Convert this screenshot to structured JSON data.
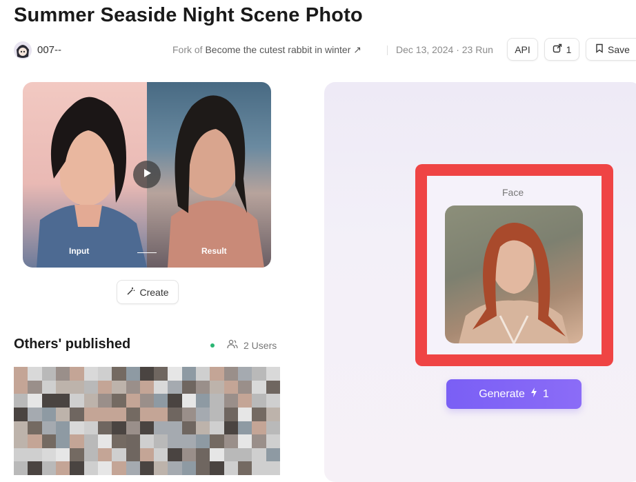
{
  "header": {
    "title": "Summer Seaside Night Scene Photo",
    "username": "007--",
    "fork_prefix": "Fork of",
    "fork_link": "Become the cutest rabbit in winter ↗",
    "date": "Dec 13, 2024",
    "runs_separator": "·",
    "runs": "23 Run",
    "api_label": "API",
    "share_count": "1",
    "save_label": "Save"
  },
  "preview": {
    "input_label": "Input",
    "result_label": "Result",
    "create_label": "Create"
  },
  "others": {
    "title": "Others' published",
    "users_label": "2 Users"
  },
  "panel": {
    "face_label": "Face",
    "generate_label": "Generate",
    "generate_cost": "1"
  },
  "colors": {
    "accent": "#7a5ff5",
    "highlight": "#ef4444",
    "online": "#2bb673"
  },
  "icons": [
    "avatar",
    "share-icon",
    "bookmark-icon",
    "play-icon",
    "magic-wand-icon",
    "users-icon",
    "lightning-icon"
  ]
}
